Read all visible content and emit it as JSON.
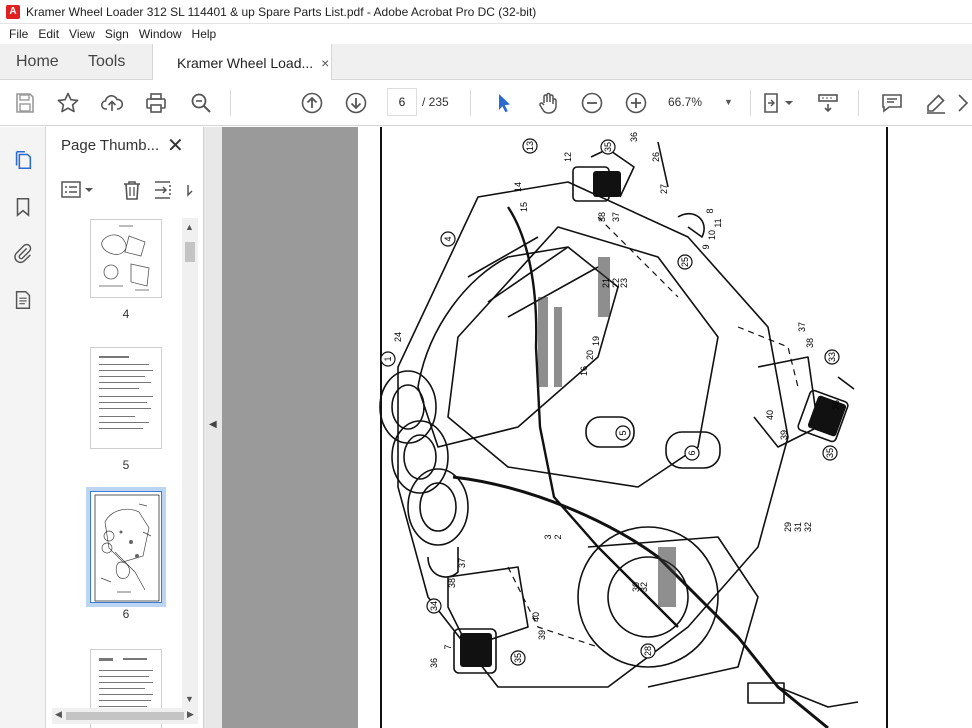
{
  "window": {
    "title": "Kramer Wheel Loader 312 SL 114401 & up Spare Parts List.pdf - Adobe Acrobat Pro DC (32-bit)"
  },
  "menu": [
    "File",
    "Edit",
    "View",
    "Sign",
    "Window",
    "Help"
  ],
  "tabs": {
    "home": "Home",
    "tools": "Tools",
    "document": "Kramer Wheel Load...",
    "close": "×"
  },
  "toolbar": {
    "current_page": "6",
    "page_total": "/ 235",
    "zoom": "66.7%"
  },
  "thumbnails_panel": {
    "title": "Page Thumb...",
    "close": "✕",
    "pages": [
      {
        "label": "4"
      },
      {
        "label": "5"
      },
      {
        "label": "6",
        "selected": true
      }
    ]
  },
  "callouts": [
    "13",
    "12",
    "35",
    "36",
    "26",
    "27",
    "14",
    "15",
    "4",
    "9",
    "10",
    "11",
    "8",
    "25",
    "38",
    "37",
    "21",
    "22",
    "23",
    "24",
    "1",
    "16",
    "20",
    "19",
    "5",
    "6",
    "33",
    "37",
    "38",
    "36",
    "40",
    "39",
    "35",
    "29",
    "31",
    "32",
    "3",
    "2",
    "30",
    "32",
    "38",
    "37",
    "34",
    "40",
    "39",
    "7",
    "36",
    "35",
    "28"
  ],
  "colors": {
    "accent": "#3a7bd5",
    "selection_glow": "#bcd6f2",
    "doc_background": "#9a9a9a",
    "acrobat_red": "#e02020"
  }
}
